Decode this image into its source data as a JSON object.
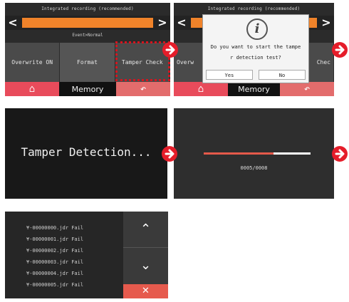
{
  "panel1": {
    "header": "Integrated recording (recommended)",
    "sub": "Event>Normal",
    "buttons": [
      "Overwrite ON",
      "Format",
      "Tamper Check"
    ],
    "footer_label": "Memory"
  },
  "panel2": {
    "header": "Integrated recording (recommended)",
    "dialog_line1": "Do you want to start the tampe",
    "dialog_line2": "r detection test?",
    "yes": "Yes",
    "no": "No",
    "bg_left": "Overw",
    "bg_right": "Chec",
    "footer_label": "Memory"
  },
  "panel3": {
    "text": "Tamper Detection..."
  },
  "panel4": {
    "counter": "0005/0008",
    "progress": 0.65
  },
  "panel5": {
    "files": [
      "¥-00000000.jdr Fail",
      "¥-00000001.jdr Fail",
      "¥-00000002.jdr Fail",
      "¥-00000003.jdr Fail",
      "¥-00000004.jdr Fail",
      "¥-00000005.jdr Fail"
    ]
  },
  "icons": {
    "left": "chevron-left-icon",
    "right": "chevron-right-icon",
    "home": "home-icon",
    "back": "back-icon",
    "info": "info-icon",
    "next": "next-arrow-icon",
    "up": "chevron-up-icon",
    "down": "chevron-down-icon",
    "close": "close-icon"
  },
  "colors": {
    "accent_orange": "#f0832a",
    "accent_red": "#e51d2a"
  }
}
